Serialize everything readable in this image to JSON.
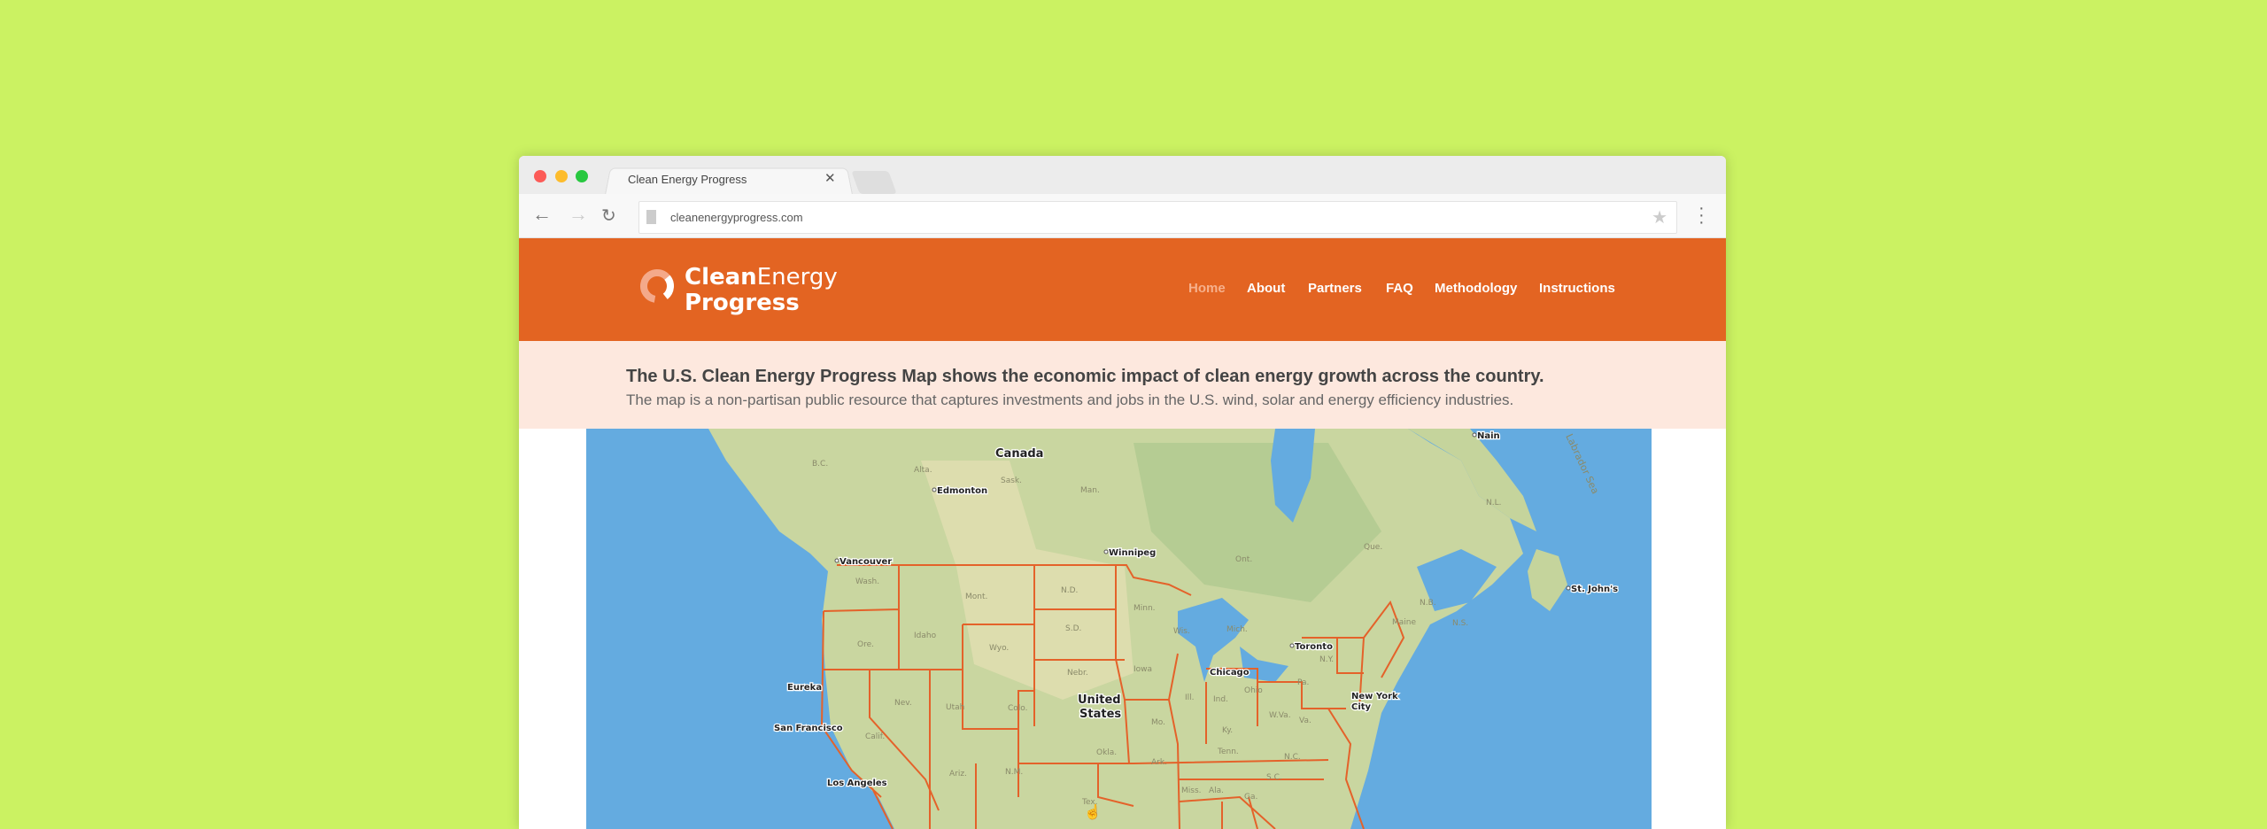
{
  "browser": {
    "tab_title": "Clean Energy Progress",
    "url": "cleanenergyprogress.com",
    "traffic_lights": {
      "close": "#fc5b57",
      "minimize": "#fdbc2c",
      "maximize": "#28c840"
    }
  },
  "header": {
    "logo": {
      "clean": "Clean",
      "energy": "Energy",
      "progress": "Progress"
    },
    "nav": [
      {
        "label": "Home",
        "active": true
      },
      {
        "label": "About"
      },
      {
        "label": "Partners"
      },
      {
        "label": "FAQ"
      },
      {
        "label": "Methodology"
      },
      {
        "label": "Instructions"
      }
    ],
    "color": "#e36422"
  },
  "intro": {
    "headline": "The U.S. Clean Energy Progress Map shows the economic impact of clean energy growth across the country.",
    "description": "The map is a non-partisan public resource that captures investments and jobs in the U.S. wind, solar and energy efficiency industries."
  },
  "map": {
    "country_labels": {
      "canada": "Canada",
      "us_line1": "United",
      "us_line2": "States"
    },
    "cities": [
      "Edmonton",
      "Winnipeg",
      "Vancouver",
      "Nain",
      "St. John's",
      "Toronto",
      "Chicago",
      "New York",
      "City",
      "Eureka",
      "San Francisco",
      "Los Angeles"
    ],
    "regions": [
      "B.C.",
      "Alta.",
      "Sask.",
      "Man.",
      "Ont.",
      "Que.",
      "N.L.",
      "N.B.",
      "N.S.",
      "Wash.",
      "Mont.",
      "N.D.",
      "Minn.",
      "S.D.",
      "Wyo.",
      "Idaho",
      "Ore.",
      "Wis.",
      "Mich.",
      "Iowa",
      "Nebr.",
      "Nev.",
      "Utah",
      "Colo.",
      "Ill.",
      "Ind.",
      "Ohio",
      "Pa.",
      "N.Y.",
      "Maine",
      "Calif.",
      "Mo.",
      "Ky.",
      "W.Va.",
      "Va.",
      "Okla.",
      "Tenn.",
      "N.C.",
      "Ark.",
      "Ariz.",
      "N.M.",
      "S.C.",
      "Miss.",
      "Ala.",
      "Ga.",
      "Tex."
    ],
    "sea_label": "Labrador Sea",
    "border_color": "#e4622a"
  }
}
